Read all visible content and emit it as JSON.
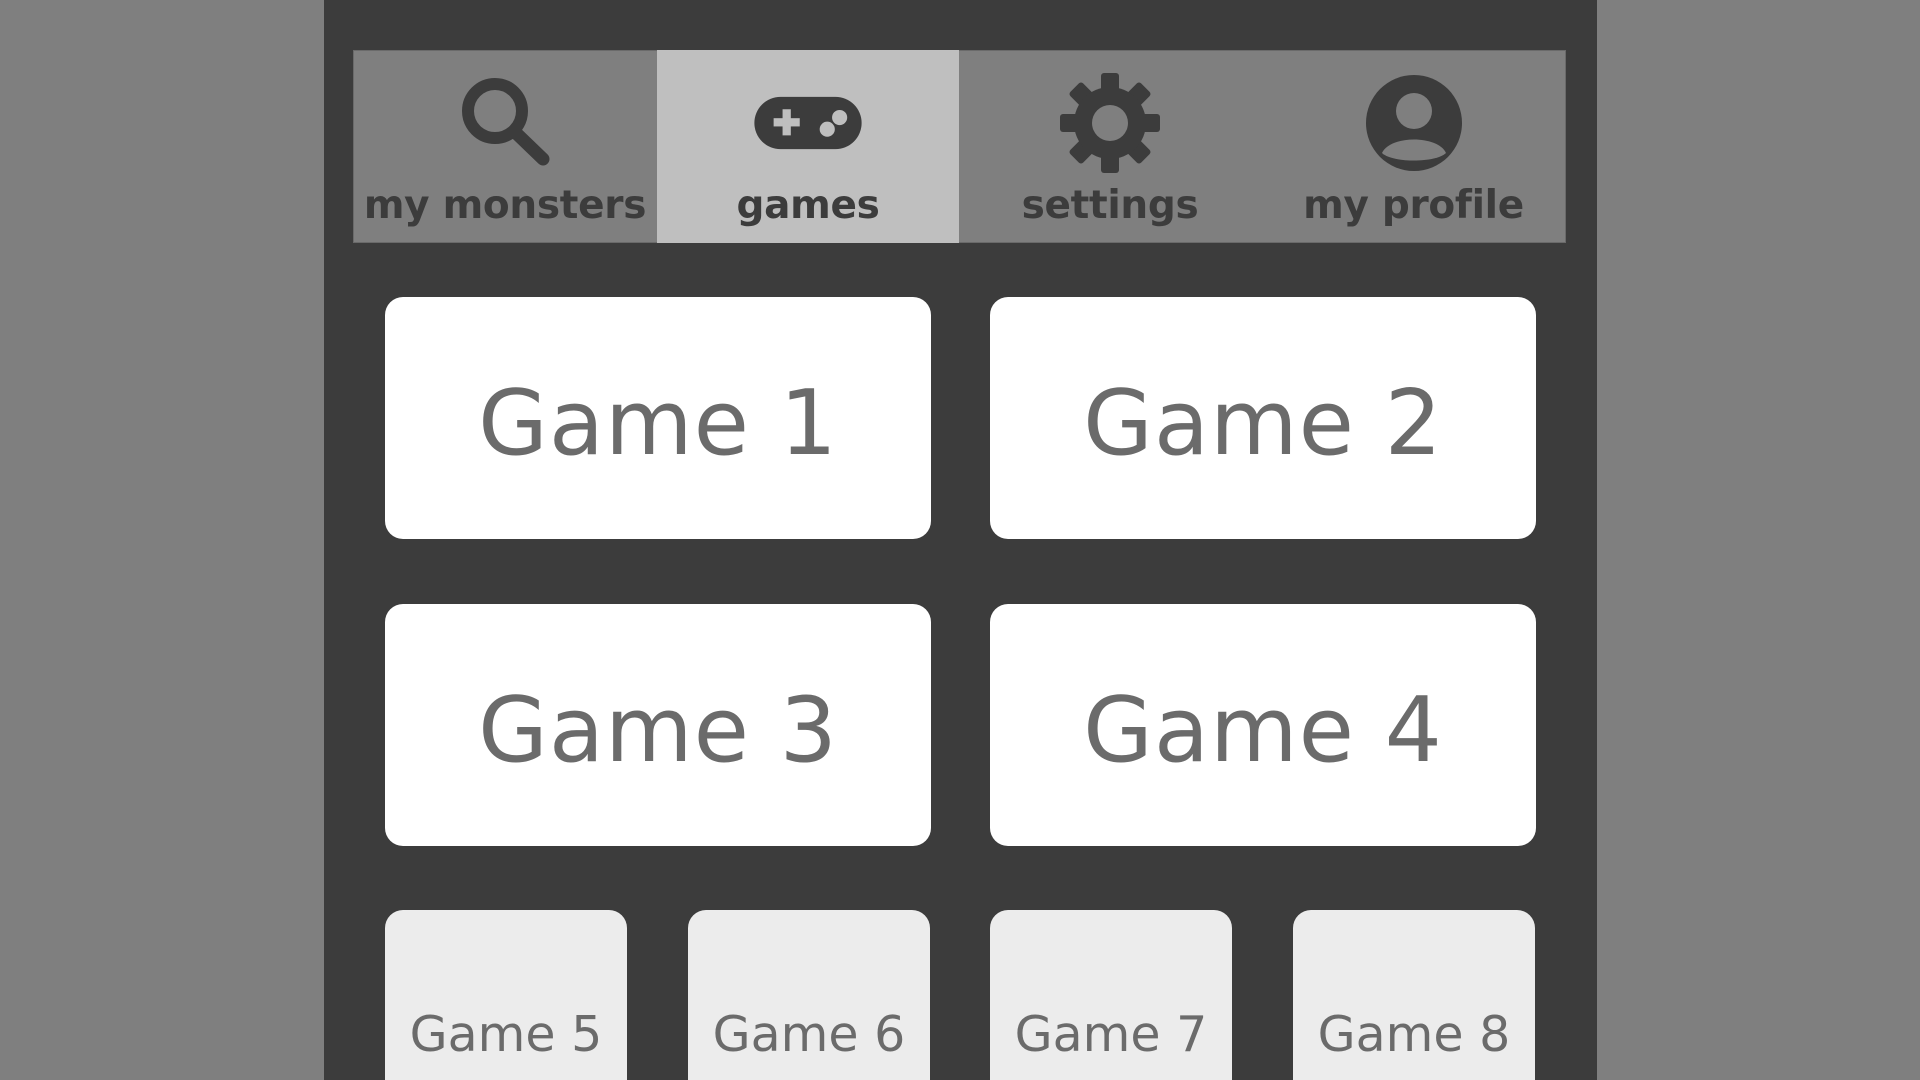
{
  "nav": {
    "items": [
      {
        "label": "my monsters",
        "icon": "search-icon",
        "active": false
      },
      {
        "label": "games",
        "icon": "gamepad-icon",
        "active": true
      },
      {
        "label": "settings",
        "icon": "gear-icon",
        "active": false
      },
      {
        "label": "my profile",
        "icon": "profile-icon",
        "active": false
      }
    ]
  },
  "games": {
    "featured": [
      {
        "label": "Game 1"
      },
      {
        "label": "Game 2"
      },
      {
        "label": "Game 3"
      },
      {
        "label": "Game 4"
      }
    ],
    "more": [
      {
        "label": "Game 5"
      },
      {
        "label": "Game 6"
      },
      {
        "label": "Game 7"
      },
      {
        "label": "Game 8"
      }
    ]
  },
  "colors": {
    "background": "#7f7f7f",
    "app_panel": "#3c3c3c",
    "nav_bar": "#7f7f7f",
    "nav_active": "#bfbfbf",
    "tile_primary": "#ffffff",
    "tile_secondary": "#ececec",
    "tile_text": "#6b6b6b"
  }
}
